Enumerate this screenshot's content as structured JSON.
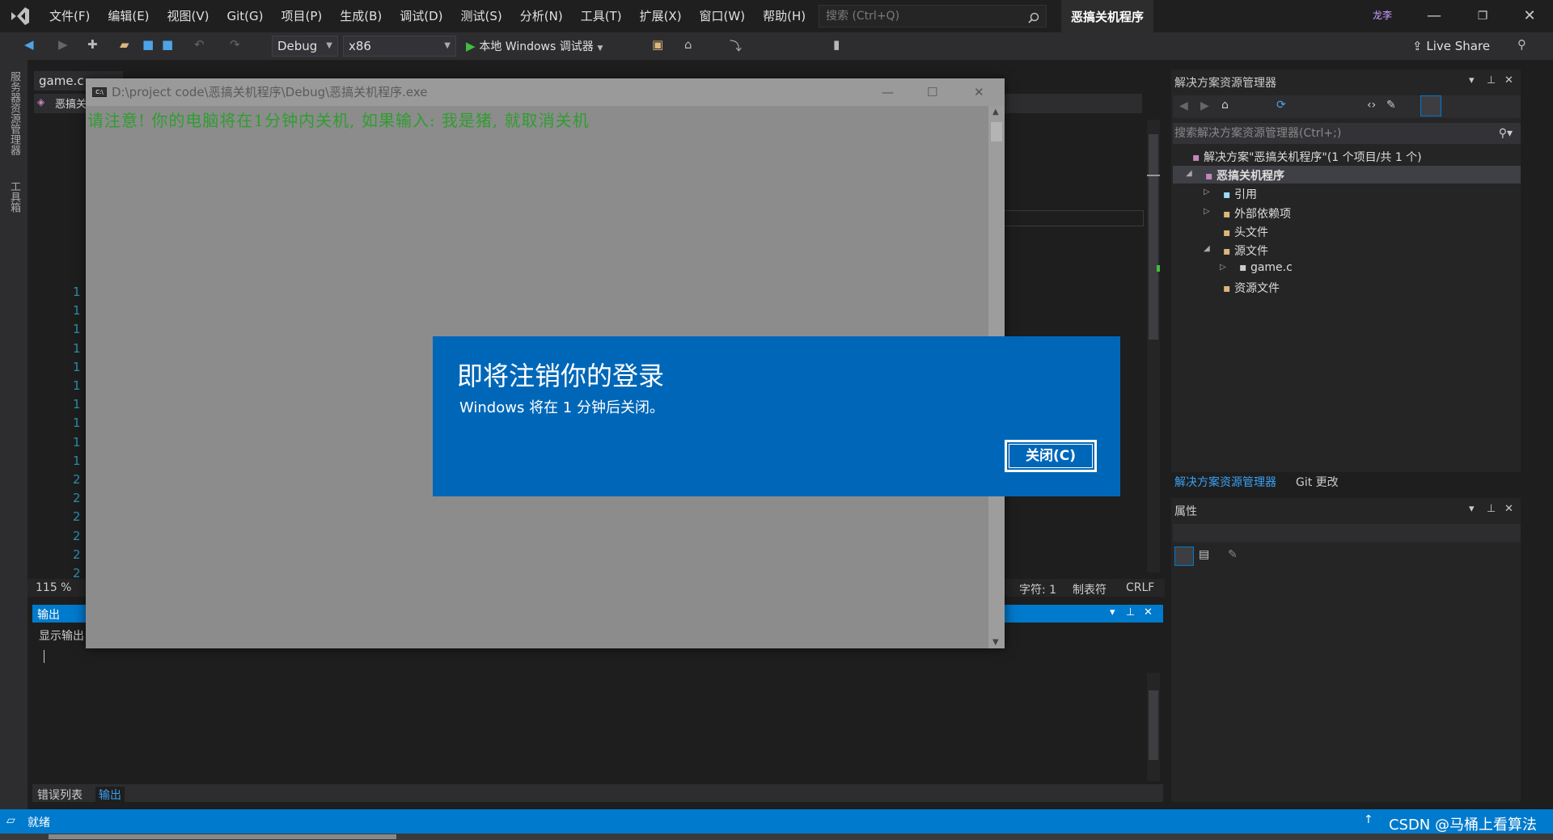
{
  "window": {
    "app_icon": "visual-studio-logo",
    "menus": [
      "文件(F)",
      "编辑(E)",
      "视图(V)",
      "Git(G)",
      "项目(P)",
      "生成(B)",
      "调试(D)",
      "测试(S)",
      "分析(N)",
      "工具(T)",
      "扩展(X)",
      "窗口(W)",
      "帮助(H)"
    ],
    "search_placeholder": "搜索 (Ctrl+Q)",
    "solution_title": "恶搞关机程序",
    "user_badge": "龙李",
    "live_share": "Live Share"
  },
  "toolbar": {
    "config": "Debug",
    "platform": "x86",
    "run_label": "本地 Windows 调试器"
  },
  "left_strip": [
    "服务器资源管理器",
    "工具箱"
  ],
  "editor": {
    "tab_label": "game.c",
    "nav_label": "恶搞关",
    "line_numbers": [
      "1",
      "1",
      "1",
      "1",
      "1",
      "1",
      "1",
      "1",
      "1",
      "1",
      "2",
      "2",
      "2",
      "2",
      "2",
      "2"
    ],
    "zoom": "115 %",
    "status_char": "字符: 1",
    "status_tab": "制表符",
    "status_eol": "CRLF"
  },
  "solution_explorer": {
    "title": "解决方案资源管理器",
    "search_placeholder": "搜索解决方案资源管理器(Ctrl+;)",
    "items": [
      {
        "label": "解决方案\"恶搞关机程序\"(1 个项目/共 1 个)",
        "icon": "solution-icon"
      },
      {
        "label": "恶搞关机程序",
        "icon": "project-icon"
      },
      {
        "label": "引用",
        "icon": "references-icon"
      },
      {
        "label": "外部依赖项",
        "icon": "folder-icon"
      },
      {
        "label": "头文件",
        "icon": "folder-icon"
      },
      {
        "label": "源文件",
        "icon": "folder-icon"
      },
      {
        "label": "game.c",
        "icon": "file-icon"
      },
      {
        "label": "资源文件",
        "icon": "folder-icon"
      }
    ],
    "tabs": [
      "解决方案资源管理器",
      "Git 更改"
    ]
  },
  "properties": {
    "title": "属性"
  },
  "output": {
    "title": "输出",
    "show_from": "显示输出",
    "bottom_tabs": [
      "错误列表",
      "输出"
    ]
  },
  "statusbar": {
    "state": "就绪",
    "watermark": "CSDN @马桶上看算法"
  },
  "console": {
    "title": "D:\\project code\\恶搞关机程序\\Debug\\恶搞关机程序.exe",
    "text": "请注意! 你的电脑将在1分钟内关机, 如果输入: 我是猪, 就取消关机"
  },
  "dialog": {
    "title": "即将注销你的登录",
    "message": "Windows 将在 1 分钟后关闭。",
    "close_label": "关闭(C)"
  },
  "colors": {
    "accent": "#007acc",
    "dialog_blue": "#0067b8",
    "console_text": "#2f9e2f"
  }
}
